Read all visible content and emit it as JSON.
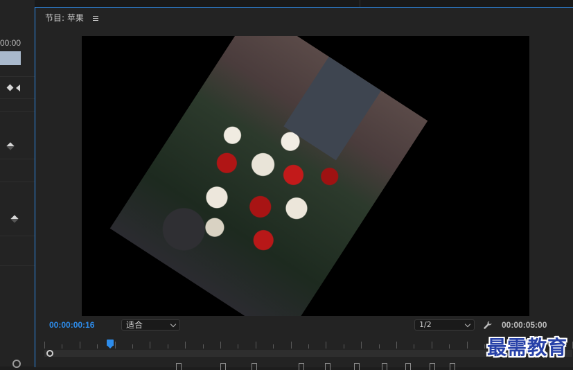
{
  "left_panel": {
    "timecode_partial": "00:00"
  },
  "monitor": {
    "title": "节目: 苹果",
    "current_timecode": "00:00:00:16",
    "fit_select": "适合",
    "resolution_select": "1/2",
    "duration_timecode": "00:00:05:00"
  },
  "watermark": "最需教育",
  "icons": {
    "menu": "hamburger-menu-icon",
    "settings": "wrench-icon"
  },
  "colors": {
    "accent": "#2d8ceb",
    "panel_bg": "#232323",
    "watermark": "#2741a8"
  }
}
